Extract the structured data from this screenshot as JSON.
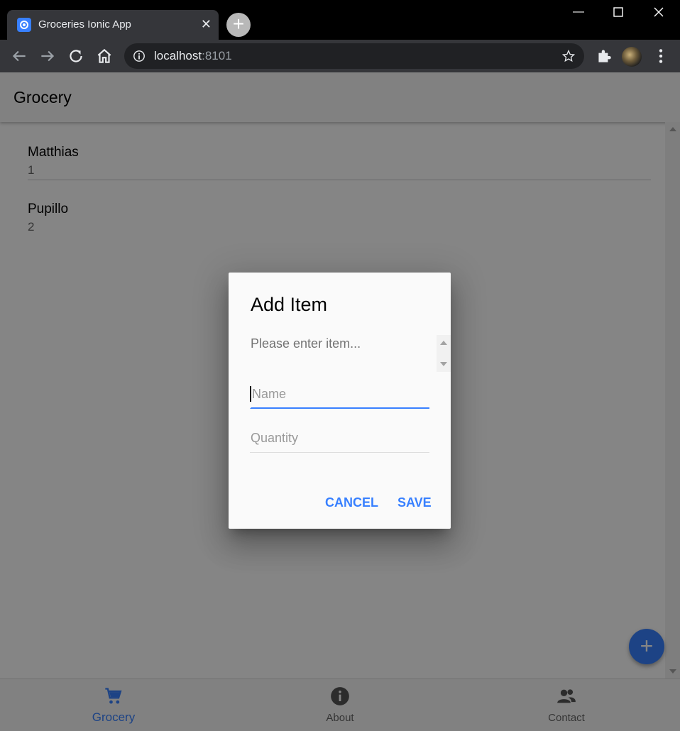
{
  "browser": {
    "tab_title": "Groceries Ionic App",
    "url_host": "localhost",
    "url_port": ":8101"
  },
  "app": {
    "header_title": "Grocery",
    "items": [
      {
        "name": "Matthias",
        "quantity": "1"
      },
      {
        "name": "Pupillo",
        "quantity": "2"
      }
    ],
    "tabs": [
      {
        "label": "Grocery",
        "icon": "cart-icon",
        "active": true
      },
      {
        "label": "About",
        "icon": "info-icon",
        "active": false
      },
      {
        "label": "Contact",
        "icon": "people-icon",
        "active": false
      }
    ],
    "accent_color": "#3880ff"
  },
  "dialog": {
    "title": "Add Item",
    "message": "Please enter item...",
    "name_placeholder": "Name",
    "quantity_placeholder": "Quantity",
    "cancel_label": "CANCEL",
    "save_label": "SAVE"
  }
}
